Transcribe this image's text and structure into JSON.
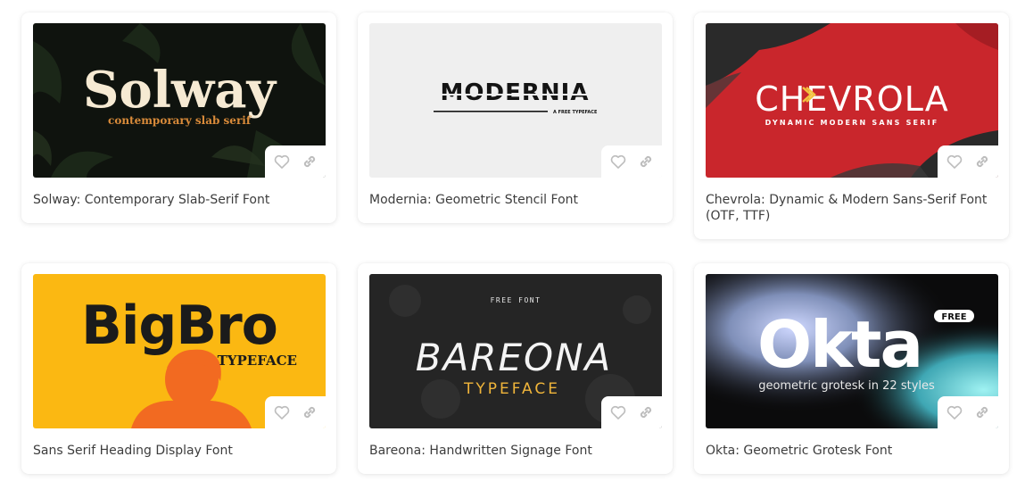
{
  "cards": [
    {
      "title": "Solway: Contemporary Slab-Serif Font",
      "preview": {
        "headline": "Solway",
        "sub": "contemporary slab serif",
        "bg": "#0f130e",
        "headline_color": "#f6ead3",
        "sub_color": "#d98b3a"
      }
    },
    {
      "title": "Modernia: Geometric Stencil Font",
      "preview": {
        "headline": "MODERNIA",
        "sub": "A FREE TYPEFACE",
        "bg": "#efefef",
        "headline_color": "#141414"
      }
    },
    {
      "title": "Chevrola: Dynamic & Modern Sans-Serif Font (OTF, TTF)",
      "preview": {
        "headline": "CHEVROLA",
        "sub": "DYNAMIC MODERN SANS SERIF",
        "bg": "#c9262c",
        "headline_color": "#ffffff",
        "accent": "#f3c23e"
      }
    },
    {
      "title": "Sans Serif Heading Display Font",
      "preview": {
        "headline": "BigBro",
        "sub": "TYPEFACE",
        "bg": "#fbb812",
        "headline_color": "#1b1b1b",
        "figure_color": "#f26a21"
      }
    },
    {
      "title": "Bareona: Handwritten Signage Font",
      "preview": {
        "top": "FREE FONT",
        "headline": "BAREONA",
        "sub": "TYPEFACE",
        "bg": "#1f1f1f",
        "headline_color": "#f4f4f4",
        "sub_color": "#f0b53a"
      }
    },
    {
      "title": "Okta: Geometric Grotesk Font",
      "preview": {
        "headline": "Okta",
        "badge": "FREE",
        "sub": "geometric grotesk in 22 styles",
        "bg": "#0b0b0c",
        "headline_color": "#ffffff"
      }
    }
  ],
  "icons": {
    "favorite": "heart-icon",
    "link": "link-icon",
    "icon_color": "#bdbdbd"
  }
}
